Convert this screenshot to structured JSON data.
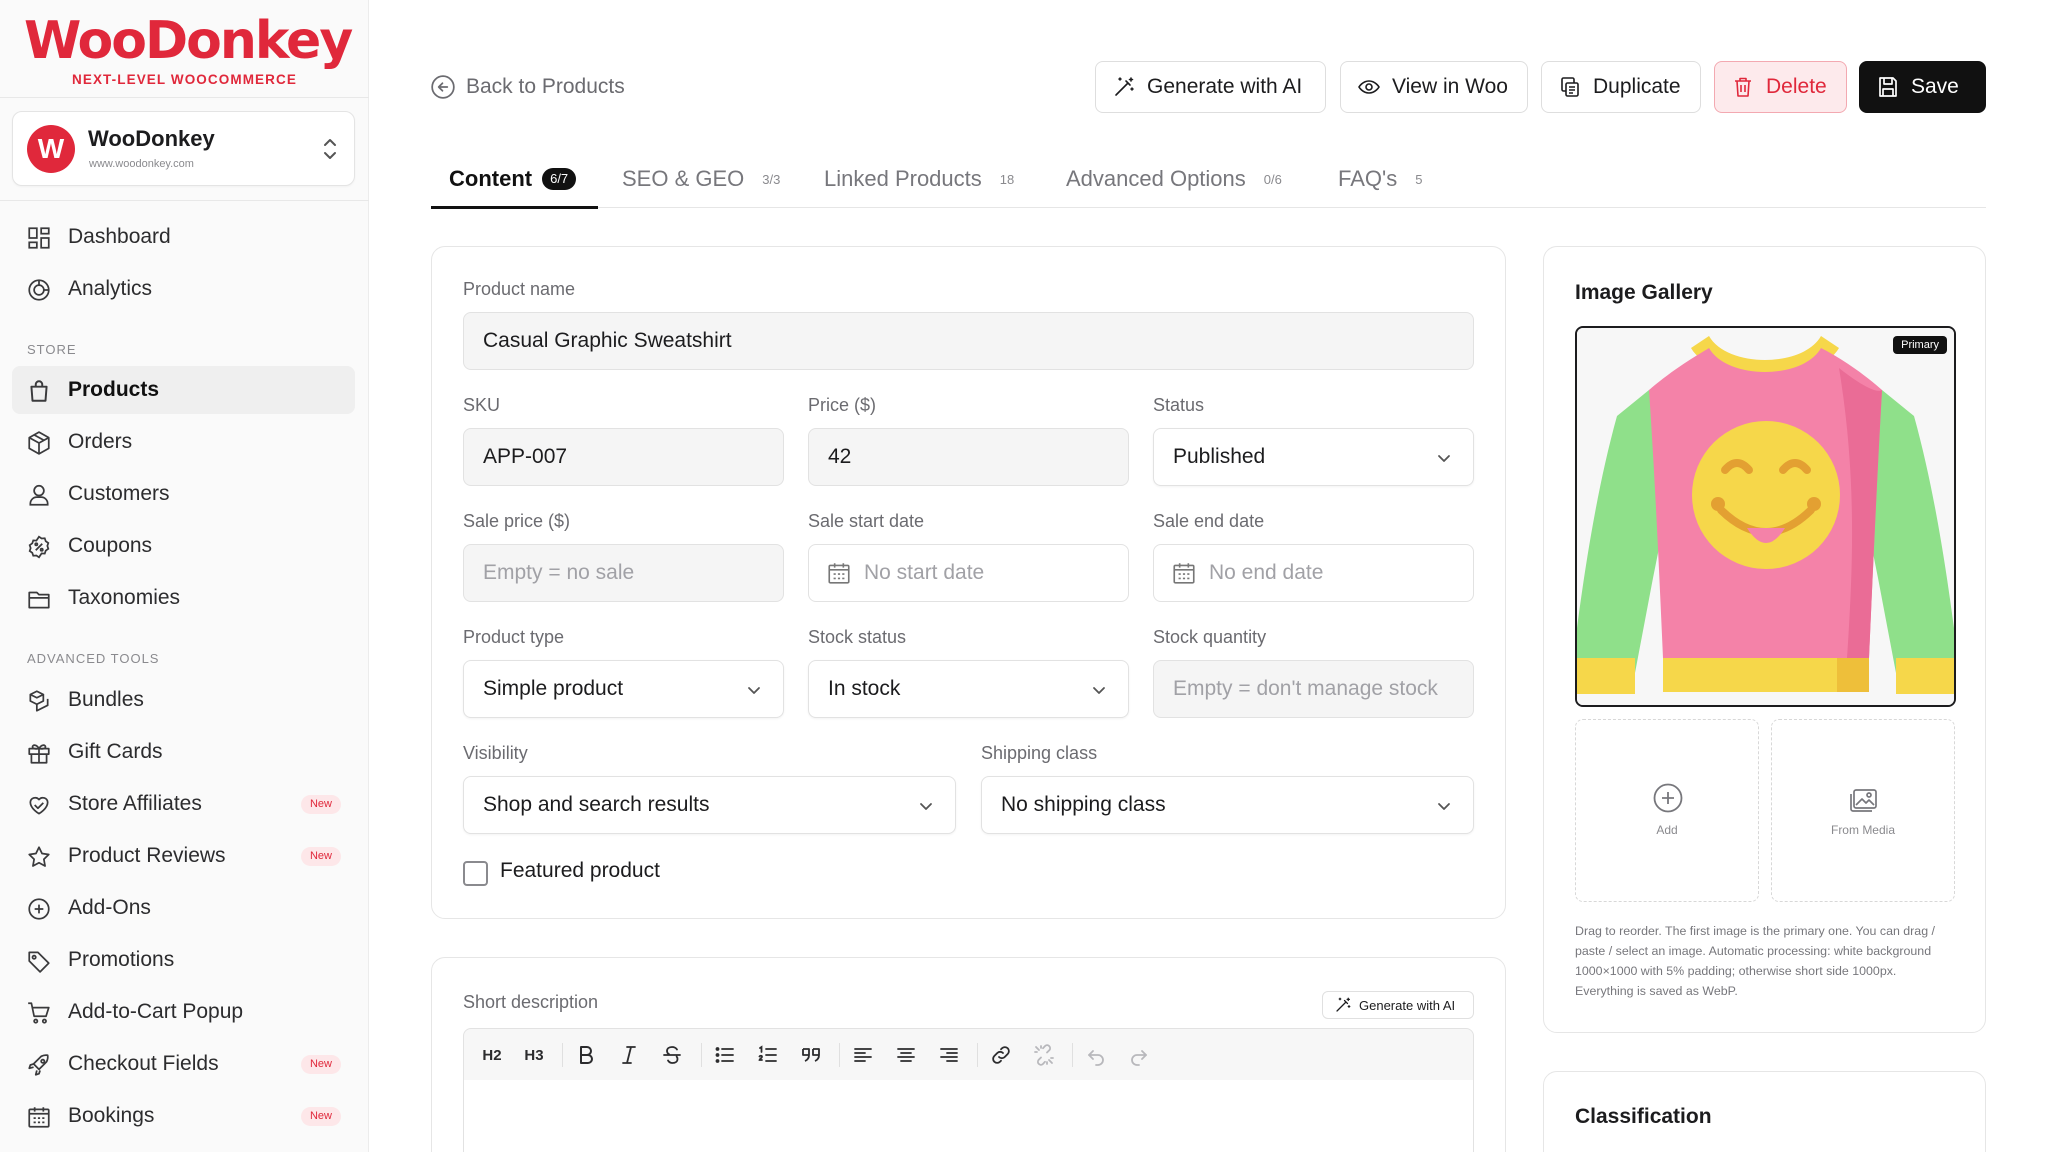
{
  "brand": {
    "name": "WooDonkey",
    "tagline": "NEXT-LEVEL WOOCOMMERCE",
    "accent": "#e0283b"
  },
  "store": {
    "initial": "W",
    "name": "WooDonkey",
    "url": "www.woodonkey.com"
  },
  "sidebar": {
    "top_items": [
      {
        "label": "Dashboard",
        "icon": "dashboard-grid-icon"
      },
      {
        "label": "Analytics",
        "icon": "analytics-icon"
      }
    ],
    "store_section": "STORE",
    "store_items": [
      {
        "label": "Products",
        "icon": "shopping-bag-icon",
        "active": true
      },
      {
        "label": "Orders",
        "icon": "box-icon"
      },
      {
        "label": "Customers",
        "icon": "user-icon"
      },
      {
        "label": "Coupons",
        "icon": "coupon-icon"
      },
      {
        "label": "Taxonomies",
        "icon": "folder-icon"
      }
    ],
    "tools_section": "ADVANCED TOOLS",
    "tools_items": [
      {
        "label": "Bundles",
        "icon": "bundles-icon"
      },
      {
        "label": "Gift Cards",
        "icon": "gift-icon"
      },
      {
        "label": "Store Affiliates",
        "icon": "affiliates-icon",
        "badge": "New"
      },
      {
        "label": "Product Reviews",
        "icon": "star-icon",
        "badge": "New"
      },
      {
        "label": "Add-Ons",
        "icon": "plus-circle-icon"
      },
      {
        "label": "Promotions",
        "icon": "tag-icon"
      },
      {
        "label": "Add-to-Cart Popup",
        "icon": "cart-icon"
      },
      {
        "label": "Checkout Fields",
        "icon": "rocket-icon",
        "badge": "New"
      },
      {
        "label": "Bookings",
        "icon": "calendar-icon",
        "badge": "New"
      }
    ]
  },
  "header": {
    "back_label": "Back to Products",
    "buttons": {
      "generate": "Generate with AI",
      "view": "View in Woo",
      "duplicate": "Duplicate",
      "delete": "Delete",
      "save": "Save"
    }
  },
  "tabs": [
    {
      "label": "Content",
      "count": "6/7",
      "active": true
    },
    {
      "label": "SEO & GEO",
      "count": "3/3"
    },
    {
      "label": "Linked Products",
      "count": "18"
    },
    {
      "label": "Advanced Options",
      "count": "0/6"
    },
    {
      "label": "FAQ's",
      "count": "5"
    }
  ],
  "form": {
    "product_name": {
      "label": "Product name",
      "value": "Casual Graphic Sweatshirt"
    },
    "sku": {
      "label": "SKU",
      "value": "APP-007"
    },
    "price": {
      "label": "Price ($)",
      "value": "42"
    },
    "status": {
      "label": "Status",
      "value": "Published"
    },
    "sale_price": {
      "label": "Sale price ($)",
      "placeholder": "Empty = no sale"
    },
    "sale_start": {
      "label": "Sale start date",
      "placeholder": "No start date"
    },
    "sale_end": {
      "label": "Sale end date",
      "placeholder": "No end date"
    },
    "product_type": {
      "label": "Product type",
      "value": "Simple product"
    },
    "stock_status": {
      "label": "Stock status",
      "value": "In stock"
    },
    "stock_quantity": {
      "label": "Stock quantity",
      "placeholder": "Empty = don't manage stock"
    },
    "visibility": {
      "label": "Visibility",
      "value": "Shop and search results"
    },
    "shipping_class": {
      "label": "Shipping class",
      "value": "No shipping class"
    },
    "featured": {
      "label": "Featured product",
      "checked": false
    }
  },
  "short_description": {
    "label": "Short description",
    "generate_label": "Generate with AI",
    "toolbar": {
      "h2": "H2",
      "h3": "H3"
    }
  },
  "gallery": {
    "title": "Image Gallery",
    "primary_tag": "Primary",
    "add_label": "Add",
    "media_label": "From Media",
    "note": "Drag to reorder. The first image is the primary one. You can drag / paste / select an image. Automatic processing: white background 1000×1000 with 5% padding; otherwise short side 1000px. Everything is saved as WebP."
  },
  "classification": {
    "title": "Classification"
  }
}
